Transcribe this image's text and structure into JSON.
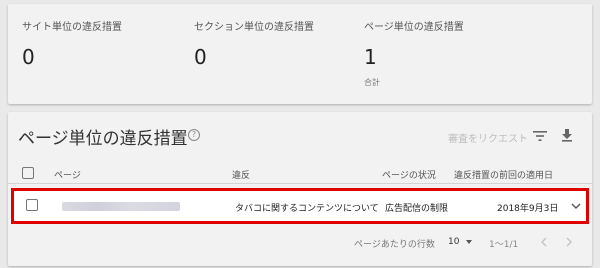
{
  "summary": {
    "site_label": "サイト単位の違反措置",
    "site_value": "0",
    "section_label": "セクション単位の違反措置",
    "section_value": "0",
    "page_label": "ページ単位の違反措置",
    "page_value": "1",
    "page_sub": "合計"
  },
  "main": {
    "title": "ページ単位の違反措置",
    "help_icon": "?",
    "request_review": "審査をリクエスト",
    "columns": {
      "page": "ページ",
      "violation": "違反",
      "status": "ページの状況",
      "date": "違反措置の前回の適用日"
    },
    "row": {
      "violation": "タバコに関するコンテンツについて",
      "status": "広告配信の制限",
      "date": "2018年9月3日"
    },
    "footer": {
      "rows_per_page_label": "ページあたりの行数",
      "rows_per_page_value": "10",
      "range": "1〜1/1"
    }
  },
  "colors": {
    "highlight_border": "#e00000",
    "card_bg": "#f2f2f2",
    "page_bg": "#e9e9e9"
  },
  "icons": [
    "help-icon",
    "filter-icon",
    "download-icon",
    "chevron-down-icon",
    "chevron-left-icon",
    "chevron-right-icon"
  ]
}
